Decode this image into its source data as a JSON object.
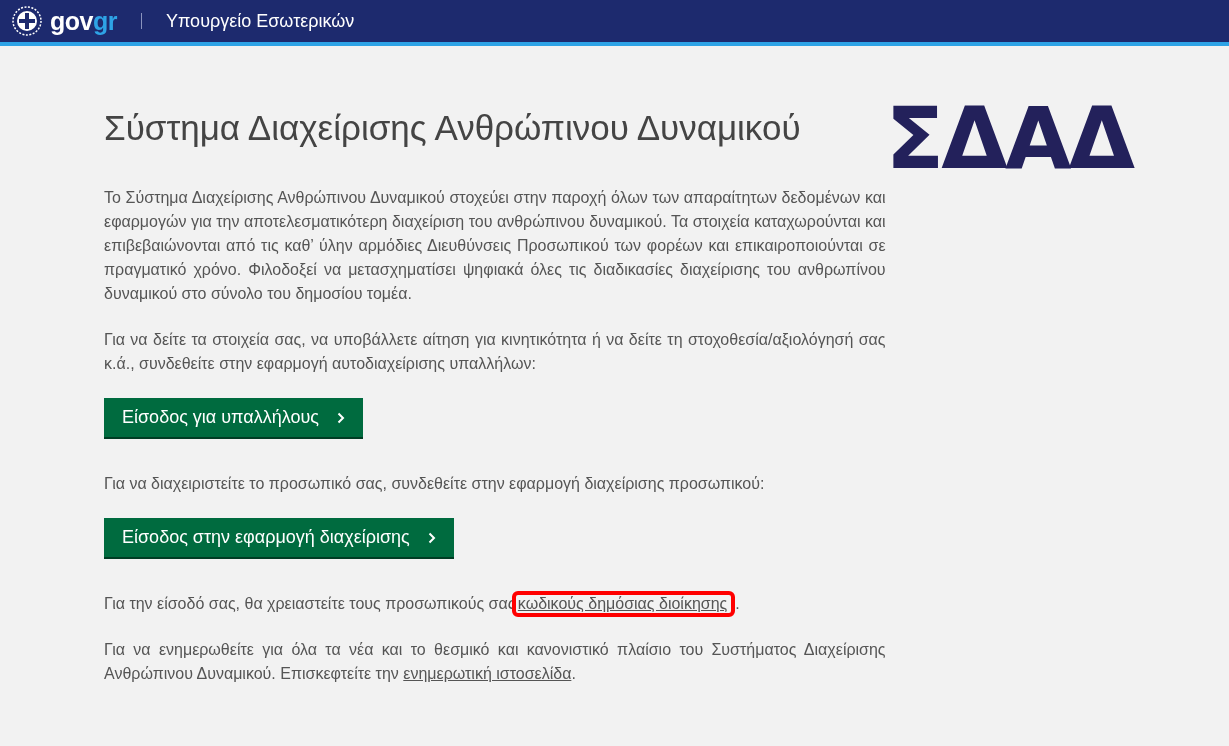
{
  "header": {
    "brand_gov": "gov",
    "brand_gr": "gr",
    "ministry": "Υπουργείο Εσωτερικών"
  },
  "title": "Σύστημα Διαχείρισης Ανθρώπινου Δυναμικού",
  "logo": "ΣΔΑΔ",
  "blocks": [
    {
      "kind": "paragraph",
      "text": "Το Σύστημα Διαχείρισης Ανθρώπινου Δυναμικού στοχεύει στην παροχή όλων των απαραίτητων δεδομένων και εφαρμογών για την αποτελεσματικότερη διαχείριση του ανθρώπινου δυναμικού. Τα στοιχεία καταχωρούνται και επιβεβαιώνονται από τις καθ’ ύλην αρμόδιες Διευθύνσεις Προσωπικού των φορέων και επικαιροποιούνται σε πραγματικό χρόνο. Φιλοδοξεί να μετασχηματίσει ψηφιακά όλες τις διαδικασίες διαχείρισης του ανθρωπίνου δυναμικού στο σύνολο του δημοσίου τομέα."
    },
    {
      "kind": "paragraph",
      "text": "Για να δείτε τα στοιχεία σας, να υποβάλλετε αίτηση για κινητικότητα ή να δείτε τη στοχοθεσία/αξιολόγησή σας κ.ά., συνδεθείτε στην εφαρμογή αυτοδιαχείρισης υπαλλήλων:"
    },
    {
      "kind": "button",
      "label": "Είσοδος για υπαλλήλους"
    },
    {
      "kind": "paragraph",
      "text": "Για να διαχειριστείτε το προσωπικό σας, συνδεθείτε στην εφαρμογή διαχείρισης προσωπικού:"
    },
    {
      "kind": "button",
      "label": "Είσοδος στην εφαρμογή διαχείρισης"
    },
    {
      "kind": "paragraph",
      "text": "Για την είσοδό σας, θα χρειαστείτε τους προσωπικούς σας",
      "link": {
        "text": "κωδικούς δημόσιας διοίκησης",
        "highlighted": true
      },
      "after": "."
    },
    {
      "kind": "paragraph",
      "text": "Για να ενημερωθείτε για όλα τα νέα και το θεσμικό και κανονιστικό πλαίσιο του Συστήματος Διαχείρισης Ανθρώπινου Δυναμικού. Επισκεφτείτε την",
      "link": {
        "text": "ενημερωτική ιστοσελίδα",
        "highlighted": false
      },
      "after": "."
    }
  ]
}
